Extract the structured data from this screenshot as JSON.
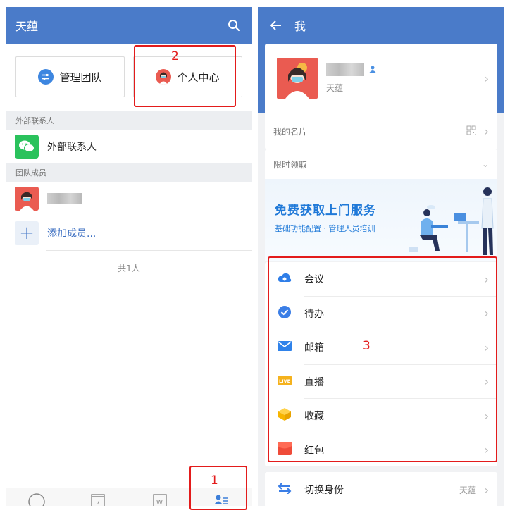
{
  "left": {
    "header": {
      "title": "天蕴",
      "search_icon": "search-icon"
    },
    "quick": {
      "manage_team": "管理团队",
      "personal_center": "个人中心"
    },
    "sections": {
      "external_header": "外部联系人",
      "external_item": "外部联系人",
      "team_header": "团队成员",
      "add_member": "添加成员..."
    },
    "member_count": "共1人",
    "nav": [
      "chat-icon",
      "calendar-icon",
      "docs-icon",
      "contacts-icon"
    ]
  },
  "right": {
    "header": {
      "title": "我",
      "back_icon": "back-arrow-icon"
    },
    "profile": {
      "org": "天蕴",
      "namecard": "我的名片"
    },
    "promo": {
      "head": "限时领取",
      "title": "免费获取上门服务",
      "subtitle": "基础功能配置 · 管理人员培训"
    },
    "menu": [
      {
        "label": "会议",
        "icon": "meeting-cloud-icon"
      },
      {
        "label": "待办",
        "icon": "todo-check-icon"
      },
      {
        "label": "邮箱",
        "icon": "mail-icon"
      },
      {
        "label": "直播",
        "icon": "live-icon"
      },
      {
        "label": "收藏",
        "icon": "favorite-box-icon"
      },
      {
        "label": "红包",
        "icon": "red-packet-icon"
      }
    ],
    "switch": {
      "label": "切换身份",
      "value": "天蕴"
    }
  },
  "annotations": {
    "one": "1",
    "two": "2",
    "three": "3"
  },
  "colors": {
    "header_blue": "#4a7bc9",
    "annotation_red": "#e31b1b",
    "wechat_green": "#2ac25c"
  }
}
